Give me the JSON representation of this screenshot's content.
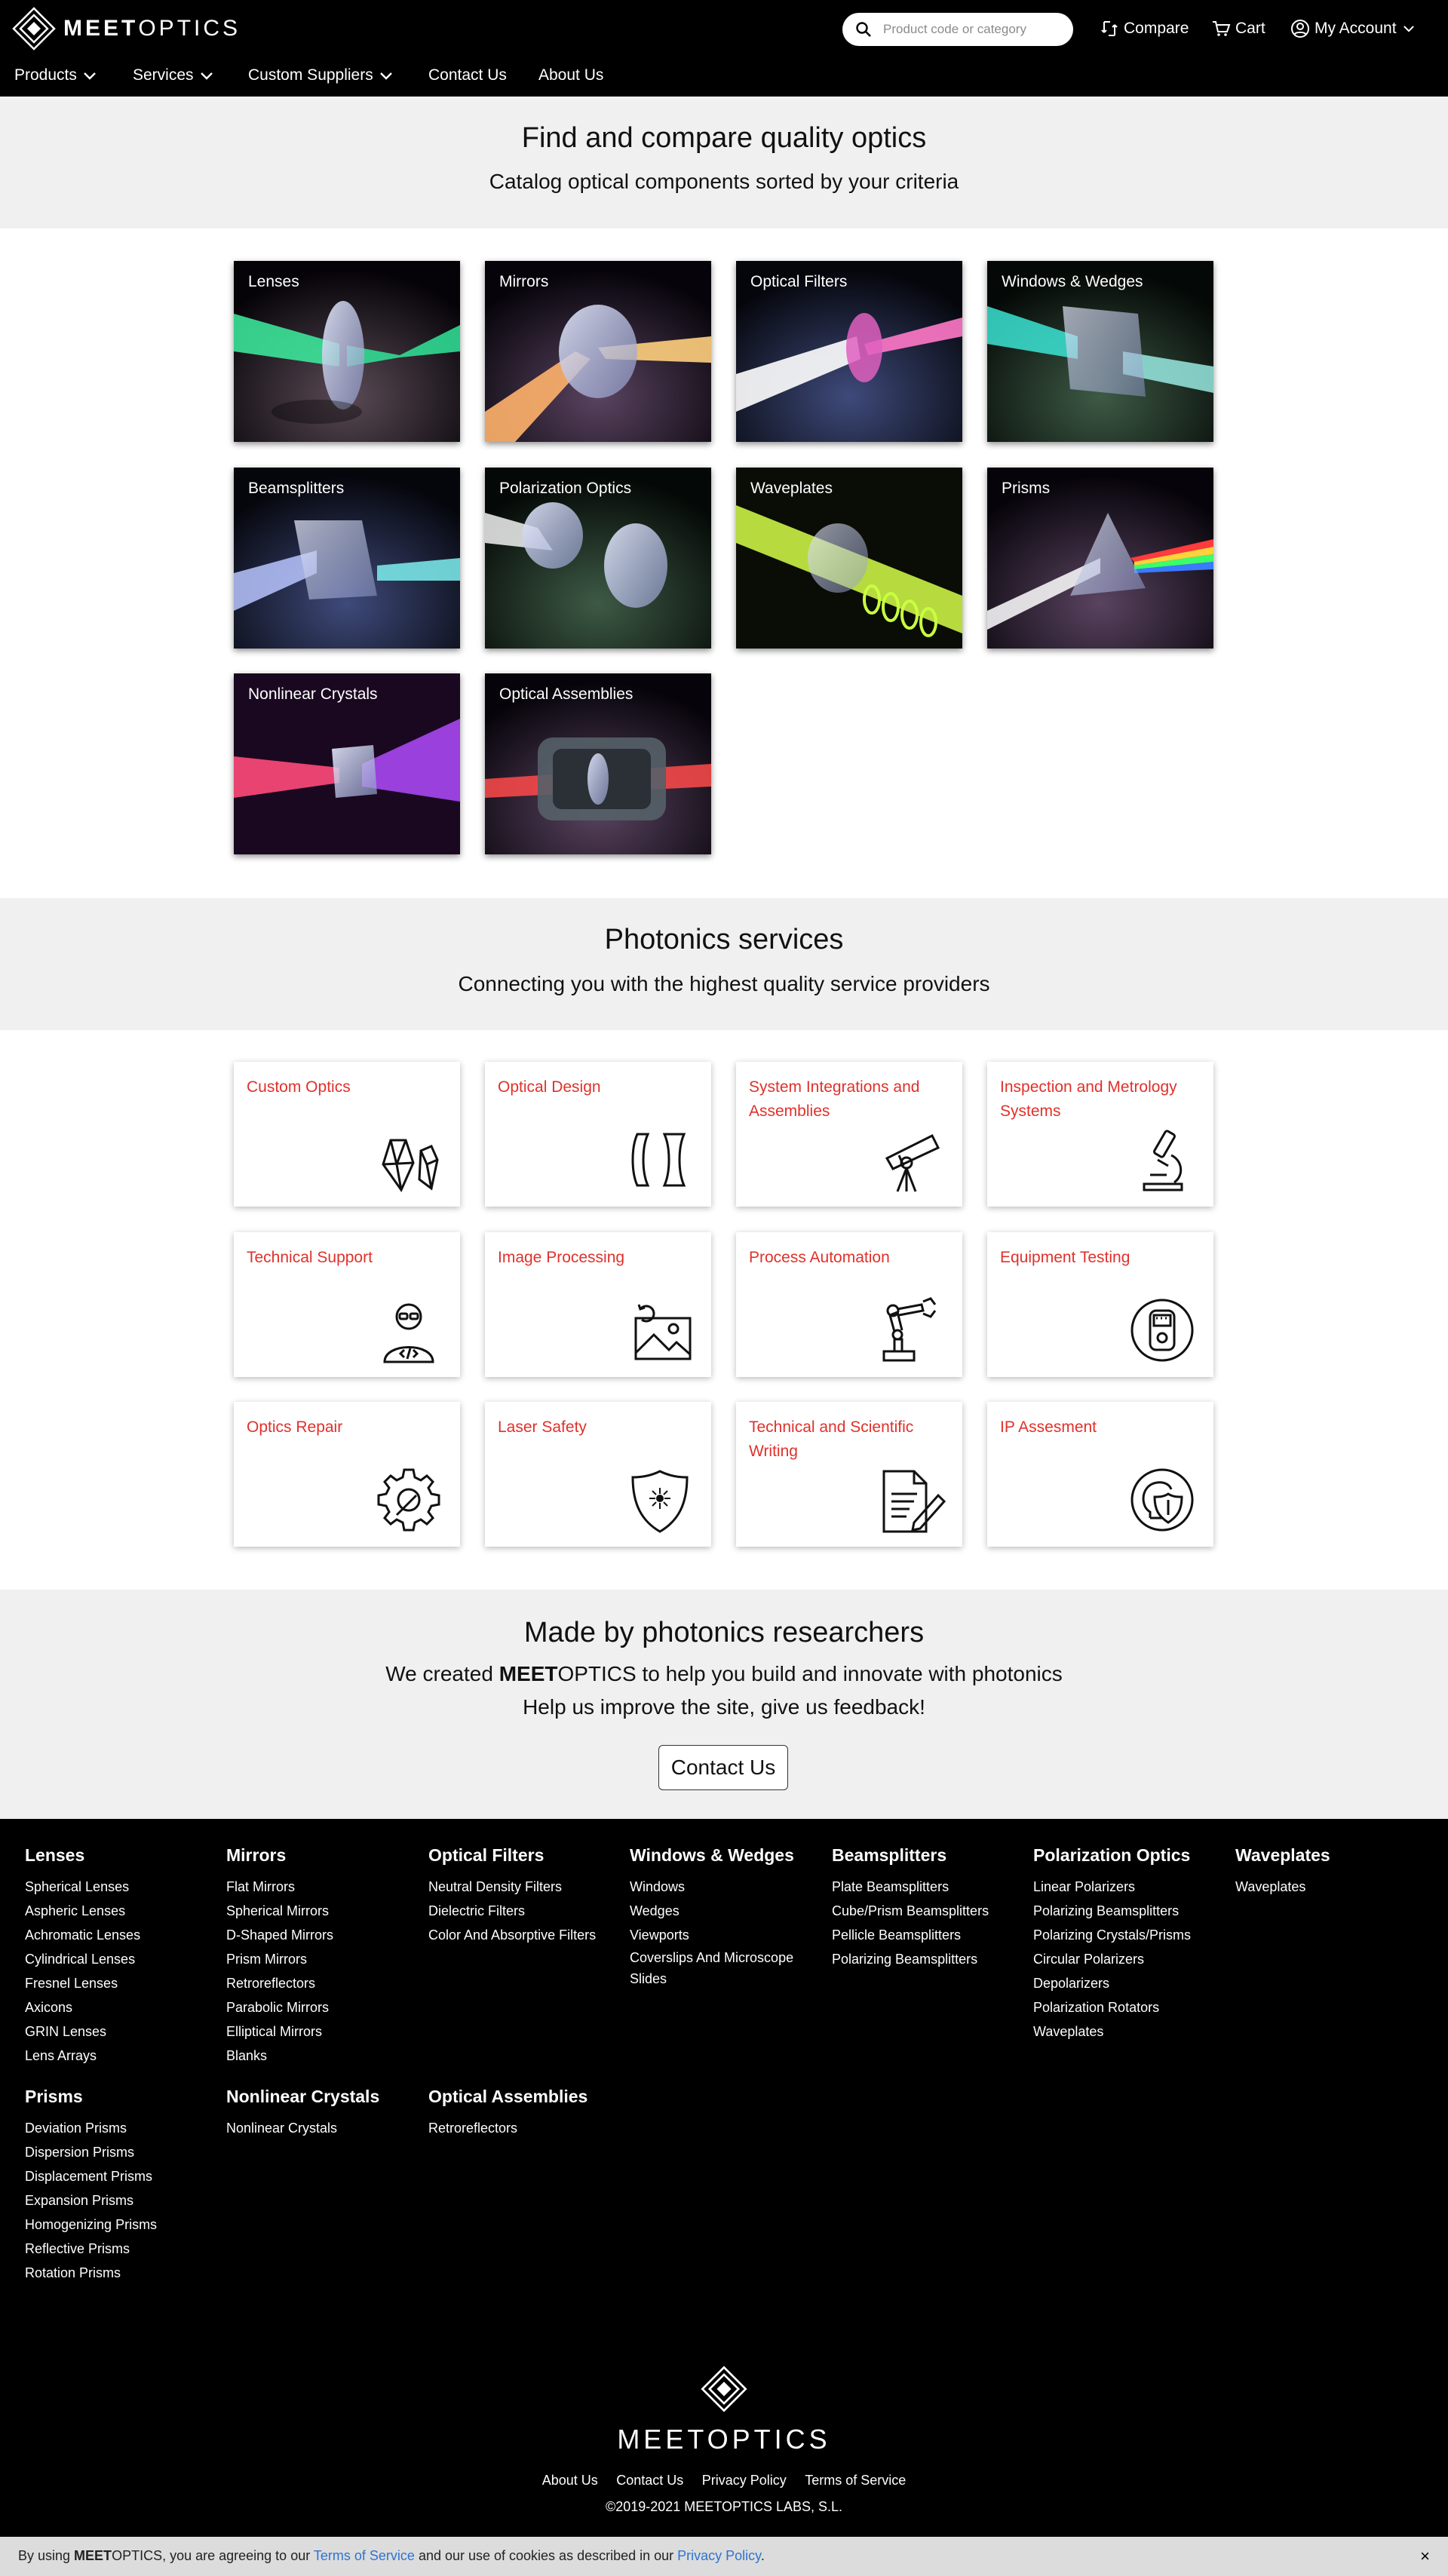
{
  "header": {
    "logo_bold": "MEET",
    "logo_light": "OPTICS",
    "search_placeholder": "Product code or category",
    "compare": "Compare",
    "cart": "Cart",
    "account": "My Account"
  },
  "nav": [
    "Products",
    "Services",
    "Custom Suppliers",
    "Contact Us",
    "About Us"
  ],
  "catalog": {
    "title": "Find and compare quality optics",
    "subtitle": "Catalog optical components sorted by your criteria",
    "tiles": [
      "Lenses",
      "Mirrors",
      "Optical Filters",
      "Windows & Wedges",
      "Beamsplitters",
      "Polarization Optics",
      "Waveplates",
      "Prisms",
      "Nonlinear Crystals",
      "Optical Assemblies"
    ]
  },
  "services": {
    "title": "Photonics services",
    "subtitle": "Connecting you with the highest quality service providers",
    "cards": [
      {
        "label": "Custom Optics",
        "icon": "crystal-icon"
      },
      {
        "label": "Optical Design",
        "icon": "lens-design-icon"
      },
      {
        "label": "System Integrations and Assemblies",
        "icon": "telescope-icon"
      },
      {
        "label": "Inspection and Metrology Systems",
        "icon": "microscope-icon"
      },
      {
        "label": "Technical Support",
        "icon": "developer-icon"
      },
      {
        "label": "Image Processing",
        "icon": "image-icon"
      },
      {
        "label": "Process Automation",
        "icon": "robot-arm-icon"
      },
      {
        "label": "Equipment Testing",
        "icon": "tester-icon"
      },
      {
        "label": "Optics Repair",
        "icon": "gear-wrench-icon"
      },
      {
        "label": "Laser Safety",
        "icon": "laser-shield-icon"
      },
      {
        "label": "Technical and Scientific Writing",
        "icon": "document-pen-icon"
      },
      {
        "label": "IP Assesment",
        "icon": "bulb-shield-icon"
      }
    ]
  },
  "feedback": {
    "title": "Made by photonics researchers",
    "line1_before": "We created ",
    "brand_bold": "MEET",
    "brand_light": "OPTICS",
    "line1_after": " to help you build and innovate with photonics",
    "line2": "Help us improve the site, give us feedback!",
    "button": "Contact Us"
  },
  "footer": {
    "columns": [
      {
        "title": "Lenses",
        "links": [
          "Spherical Lenses",
          "Aspheric Lenses",
          "Achromatic Lenses",
          "Cylindrical Lenses",
          "Fresnel Lenses",
          "Axicons",
          "GRIN Lenses",
          "Lens Arrays"
        ]
      },
      {
        "title": "Mirrors",
        "links": [
          "Flat Mirrors",
          "Spherical Mirrors",
          "D-Shaped Mirrors",
          "Prism Mirrors",
          "Retroreflectors",
          "Parabolic Mirrors",
          "Elliptical Mirrors",
          "Blanks"
        ]
      },
      {
        "title": "Optical Filters",
        "links": [
          "Neutral Density Filters",
          "Dielectric Filters",
          "Color And Absorptive Filters"
        ]
      },
      {
        "title": "Windows & Wedges",
        "links": [
          "Windows",
          "Wedges",
          "Viewports",
          "Coverslips And Microscope Slides"
        ]
      },
      {
        "title": "Beamsplitters",
        "links": [
          "Plate Beamsplitters",
          "Cube/Prism Beamsplitters",
          "Pellicle Beamsplitters",
          "Polarizing Beamsplitters"
        ]
      },
      {
        "title": "Polarization Optics",
        "links": [
          "Linear Polarizers",
          "Polarizing Beamsplitters",
          "Polarizing Crystals/Prisms",
          "Circular Polarizers",
          "Depolarizers",
          "Polarization Rotators",
          "Waveplates"
        ]
      },
      {
        "title": "Waveplates",
        "links": [
          "Waveplates"
        ]
      },
      {
        "title": "Prisms",
        "links": [
          "Deviation Prisms",
          "Dispersion Prisms",
          "Displacement Prisms",
          "Expansion Prisms",
          "Homogenizing Prisms",
          "Reflective Prisms",
          "Rotation Prisms"
        ]
      },
      {
        "title": "Nonlinear Crystals",
        "links": [
          "Nonlinear Crystals"
        ]
      },
      {
        "title": "Optical Assemblies",
        "links": [
          "Retroreflectors"
        ]
      }
    ],
    "logo": "MEETOPTICS",
    "links": [
      "About Us",
      "Contact Us",
      "Privacy Policy",
      "Terms of Service"
    ],
    "copyright": "©2019-2021 MEETOPTICS LABS, S.L."
  },
  "cookie": {
    "before": "By using ",
    "brand_bold": "MEET",
    "brand_light": "OPTICS",
    "middle": ", you are agreeing to our ",
    "terms": "Terms of Service",
    "middle2": " and our use of cookies as described in our ",
    "privacy": "Privacy Policy",
    "end": ".",
    "close": "×"
  },
  "colors": {
    "accent": "#e0312b",
    "link": "#2f74d0",
    "band": "#f0f0f0"
  }
}
